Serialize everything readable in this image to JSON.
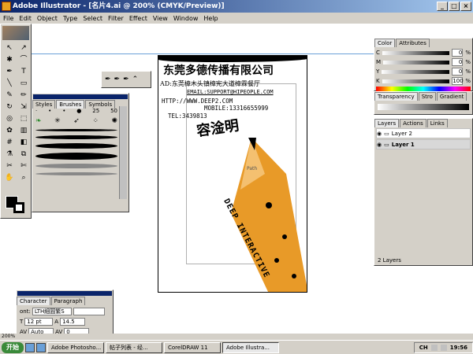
{
  "window": {
    "title": "Adobe Illustrator - [名片4.ai @ 200% (CMYK/Preview)]",
    "buttons": [
      "_",
      "□",
      "×"
    ]
  },
  "menu": [
    "File",
    "Edit",
    "Object",
    "Type",
    "Select",
    "Filter",
    "Effect",
    "View",
    "Window",
    "Help"
  ],
  "card": {
    "company": "东莞多德传播有限公司",
    "address": "AD:东莞樟木头镇樟宪大道樟霖餐厅",
    "email": "EMAIL:SUPPORT@HIPEOPLE.COM",
    "website": "HTTP://WWW.DEEP2.COM",
    "mobile": "MOBILE:13316655999",
    "tel": "TEL:3439813",
    "person": "容淦明",
    "brand": "DEEP INTERACTIVE",
    "path_label": "Path"
  },
  "brushes_panel": {
    "tabs": [
      "Styles",
      "Brushes",
      "Symbols"
    ],
    "sizes": [
      "25",
      "50"
    ]
  },
  "character_panel": {
    "tabs": [
      "Character",
      "Paragraph"
    ],
    "font_label": "ont:",
    "font": "LTH細圓繁S",
    "size": "12 pt",
    "leading": "14.5",
    "tracking": "Auto",
    "kerning": "0"
  },
  "color_panel": {
    "tabs": [
      "Color",
      "Attributes"
    ],
    "channels": [
      {
        "label": "C",
        "value": "0",
        "unit": "%"
      },
      {
        "label": "M",
        "value": "0",
        "unit": "%"
      },
      {
        "label": "Y",
        "value": "0",
        "unit": "%"
      },
      {
        "label": "K",
        "value": "100",
        "unit": "%"
      }
    ]
  },
  "transparency_panel": {
    "tabs": [
      "Transparency",
      "Stro",
      "Gradient"
    ]
  },
  "layers_panel": {
    "tabs": [
      "Layers",
      "Actions",
      "Links"
    ],
    "layers": [
      "Layer 2",
      "Layer 1"
    ],
    "footer": "2 Layers"
  },
  "status": {
    "zoom": "200%"
  },
  "taskbar": {
    "start": "开始",
    "tasks": [
      "Adobe Photosho...",
      "帖子列表 - 经...",
      "CorelDRAW 11",
      "Adobe Illustra..."
    ],
    "ime": "CH",
    "time": "19:56"
  }
}
